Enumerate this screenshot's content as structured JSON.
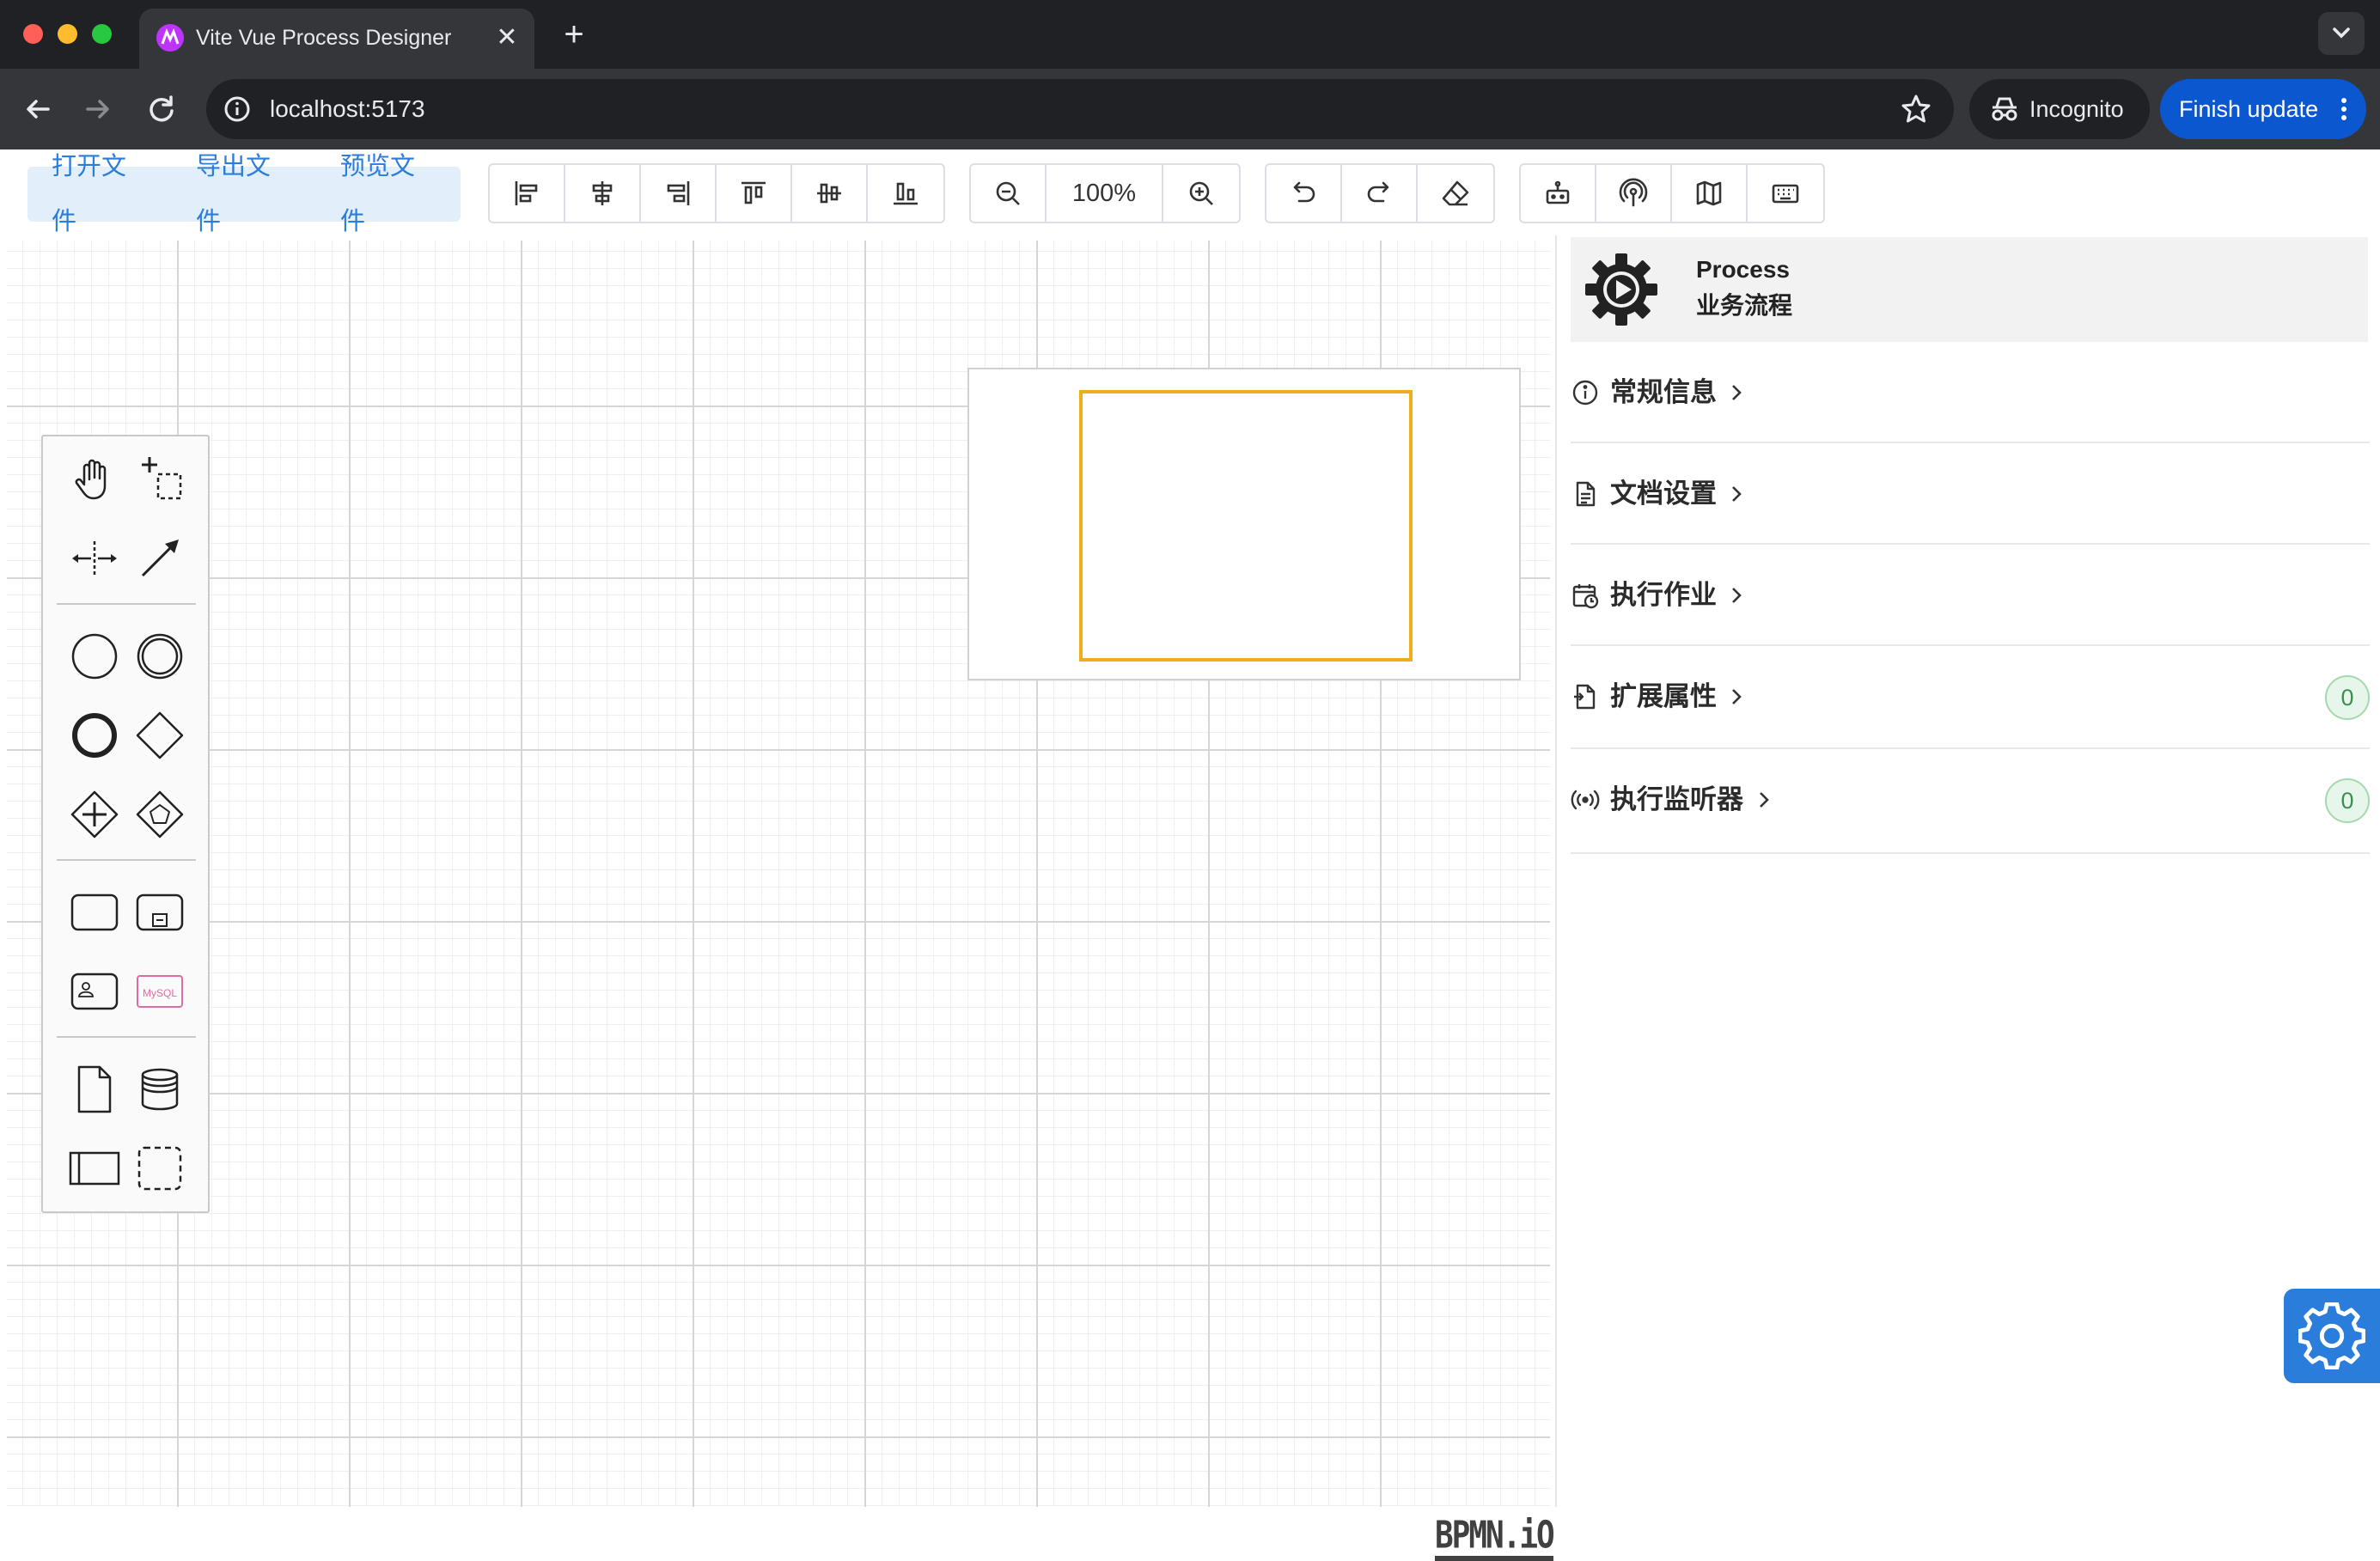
{
  "browser": {
    "tab_title": "Vite Vue Process Designer",
    "close_glyph": "✕",
    "newtab_glyph": "+",
    "url": "localhost:5173",
    "incognito_label": "Incognito",
    "finish_update_label": "Finish update"
  },
  "toolbar": {
    "file_buttons": [
      "打开文件",
      "导出文件",
      "预览文件"
    ],
    "align_icons": [
      "align-left-icon",
      "align-center-icon",
      "align-right-icon",
      "align-top-icon",
      "align-middle-icon",
      "align-bottom-icon"
    ],
    "zoom_level": "100%",
    "history_icons": [
      "undo-icon",
      "redo-icon",
      "eraser-icon"
    ],
    "tool_icons": [
      "robot-icon",
      "broadcast-icon",
      "map-icon",
      "keyboard-icon"
    ]
  },
  "palette": {
    "tools": [
      "hand-tool-icon",
      "lasso-tool-icon",
      "space-tool-icon",
      "connect-tool-icon"
    ],
    "events": [
      "start-event-icon",
      "intermediate-event-icon",
      "end-event-icon",
      "exclusive-gateway-icon",
      "parallel-gateway-icon",
      "event-gateway-icon"
    ],
    "tasks": [
      "task-icon",
      "subprocess-icon",
      "user-task-icon",
      "mysql-task-icon"
    ],
    "data": [
      "data-object-icon",
      "data-store-icon",
      "pool-icon",
      "group-icon"
    ],
    "mysql_label": "MySQL"
  },
  "canvas": {
    "watermark": "BPMN.iO"
  },
  "panel": {
    "element_type": "Process",
    "element_name": "业务流程",
    "groups": [
      {
        "label": "常规信息",
        "icon": "info-circle-icon"
      },
      {
        "label": "文档设置",
        "icon": "document-icon"
      },
      {
        "label": "执行作业",
        "icon": "calendar-clock-icon"
      },
      {
        "label": "扩展属性",
        "icon": "file-extension-icon",
        "badge": "0"
      },
      {
        "label": "执行监听器",
        "icon": "broadcast-signal-icon",
        "badge": "0"
      }
    ]
  },
  "colors": {
    "accent": "#2b7ddc",
    "viewport_outline": "#f0ad1a",
    "badge_green": "#3d8f4e"
  }
}
